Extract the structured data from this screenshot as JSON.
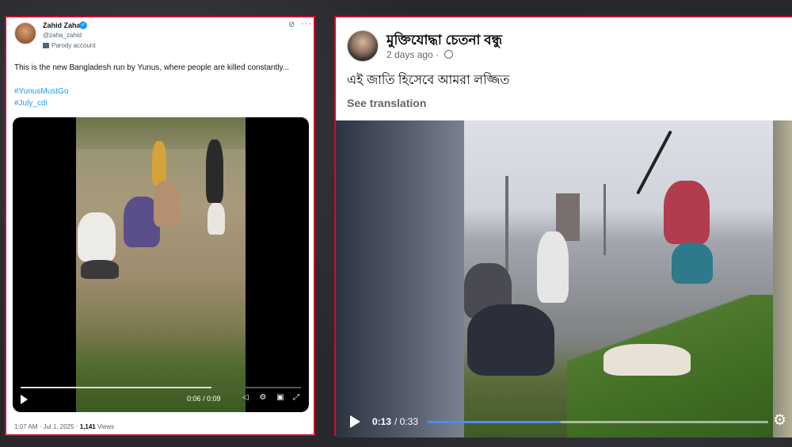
{
  "twitter": {
    "display_name": "Zahid Zaha",
    "handle": "@zaha_zahid",
    "label": "Parody account",
    "text": "This is the new Bangladesh run by Yunus, where people are killed constantly...",
    "hashtags": [
      "#YunusMustGo",
      "#July_cdi"
    ],
    "video": {
      "time": "0:06 / 0:09",
      "progress": 0.68
    },
    "timestamp": "1:07 AM · Jul 1, 2025 · ",
    "views_count": "1,141",
    "views_label": " Views"
  },
  "facebook": {
    "page_name": "মুক্তিযোদ্ধা চেতনা বন্ধু",
    "time": "2 days ago · ",
    "post_text": "এই জাতি হিসেবে আমরা লজ্জিত",
    "translate_label": "See translation",
    "video": {
      "current": "0:13",
      "separator": "/ 0:33",
      "progress": 0.39
    }
  },
  "colors": {
    "frame_border": "#c8102e",
    "twitter_link": "#1d9bf0",
    "fb_progress": "#4f8af0"
  }
}
